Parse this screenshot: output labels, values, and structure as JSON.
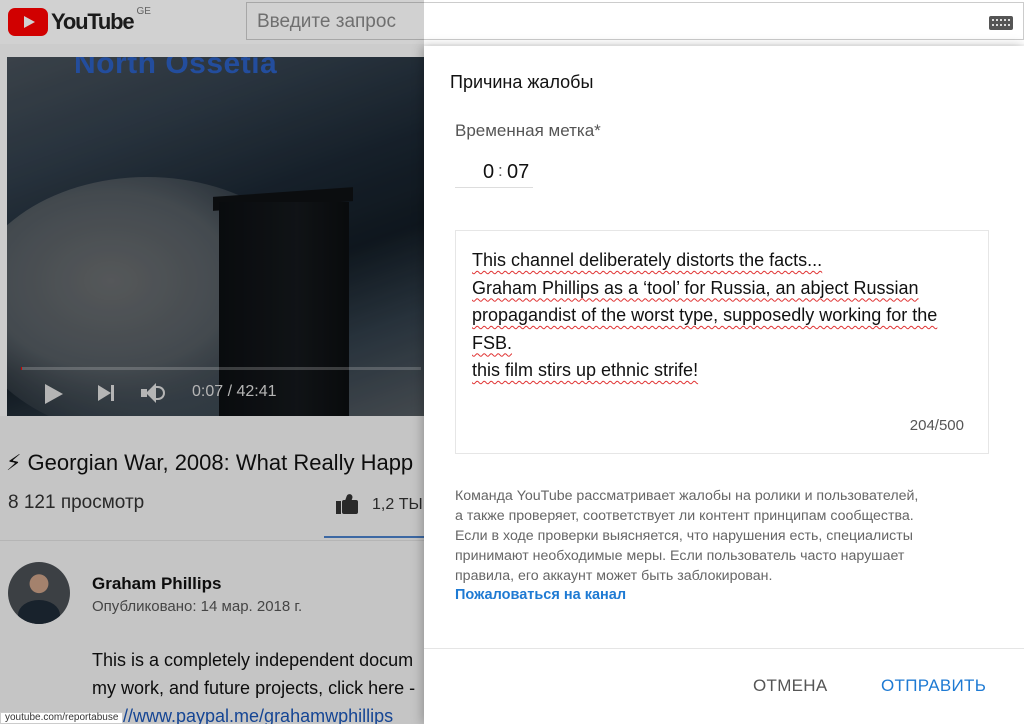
{
  "masthead": {
    "logo_text": "YouTube",
    "country_code": "GE",
    "search_placeholder": "Введите запрос"
  },
  "player": {
    "overlay_title": "North Ossetia",
    "time": "0:07 / 42:41",
    "progress": 0.003
  },
  "video": {
    "title": "⚡ Georgian War, 2008: What Really Happ",
    "views": "8 121 просмотр",
    "likes": "1,2 ТЫ",
    "channel": "Graham Phillips",
    "published": "Опубликовано: 14 мар. 2018 г.",
    "description_line1": "This is a completely independent docum",
    "description_line2": "my work, and future projects, click here -",
    "description_link": "://www.paypal.me/grahamwphillips"
  },
  "status_bar": {
    "url": "youtube.com/reportabuse"
  },
  "dialog": {
    "title": "Причина жалобы",
    "timestamp_label": "Временная метка*",
    "timestamp_minutes": "0",
    "timestamp_colon": ":",
    "timestamp_seconds": "07",
    "comment_lines": [
      "This channel deliberately distorts the facts...",
      "Graham Phillips as a ‘tool’ for Russia, an abject Russian",
      "propagandist of the worst type, supposedly working for the",
      "FSB.",
      "this film stirs up ethnic strife!"
    ],
    "char_count": "204/500",
    "info_lines": [
      "Команда YouTube рассматривает жалобы на ролики и пользователей,",
      "а также проверяет, соответствует ли контент принципам сообщества.",
      "Если в ходе проверки выясняется, что нарушения есть, специалисты",
      "принимают необходимые меры. Если пользователь часто нарушает",
      "правила, его аккаунт может быть заблокирован."
    ],
    "report_channel_link": "Пожаловаться на канал",
    "cancel_label": "ОТМЕНА",
    "submit_label": "ОТПРАВИТЬ"
  }
}
